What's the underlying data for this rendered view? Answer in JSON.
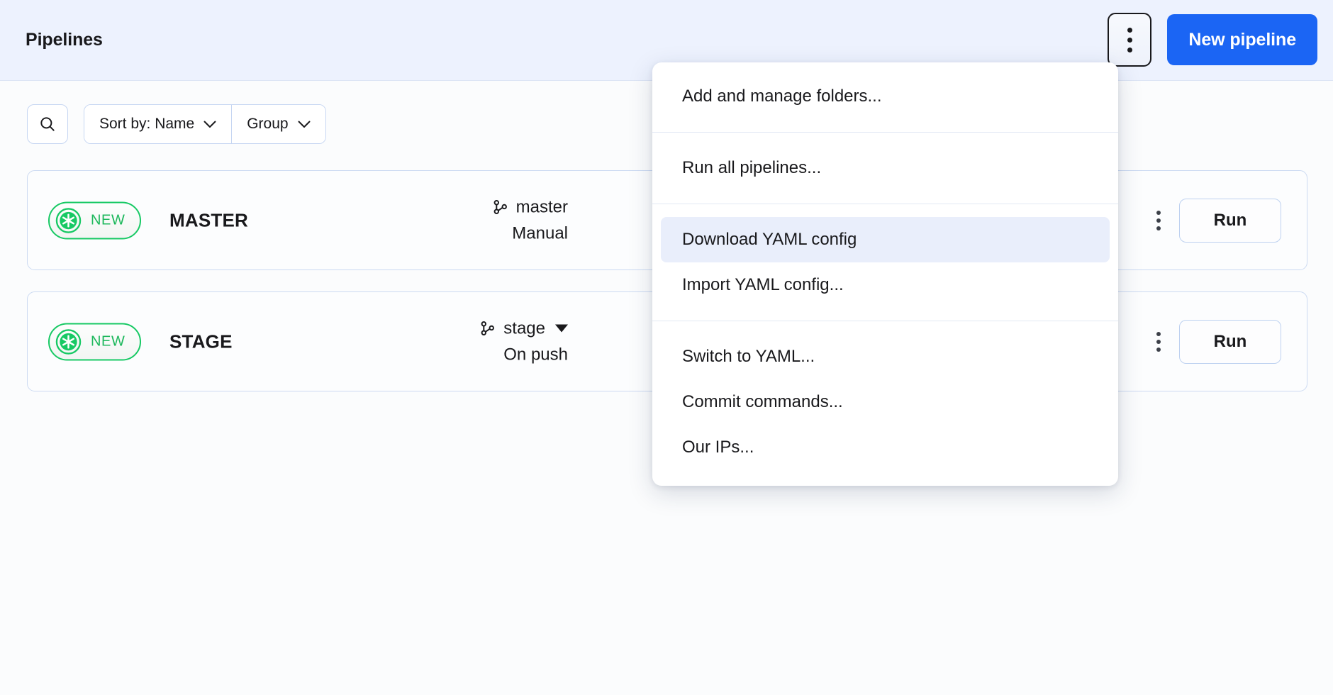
{
  "header": {
    "title": "Pipelines",
    "kebab_icon": "kebab-vertical-icon",
    "new_pipeline_label": "New pipeline",
    "accent_color": "#1b65f4",
    "background_color": "#edf2fe"
  },
  "toolbar": {
    "search_icon": "search-icon",
    "sort_label": "Sort by: Name",
    "sort_chevron_icon": "chevron-down-icon",
    "group_label": "Group",
    "group_chevron_icon": "chevron-down-icon"
  },
  "pipelines": [
    {
      "badge_label": "NEW",
      "badge_icon": "pipeline-status-new-icon",
      "badge_color": "#17c964",
      "name": "MASTER",
      "branch_icon": "git-branch-icon",
      "branch": "master",
      "branch_has_dropdown": false,
      "trigger": "Manual",
      "kebab_icon": "kebab-vertical-icon",
      "run_label": "Run"
    },
    {
      "badge_label": "NEW",
      "badge_icon": "pipeline-status-new-icon",
      "badge_color": "#17c964",
      "name": "STAGE",
      "branch_icon": "git-branch-icon",
      "branch": "stage",
      "branch_has_dropdown": true,
      "trigger": "On push",
      "kebab_icon": "kebab-vertical-icon",
      "run_label": "Run"
    }
  ],
  "menu": {
    "highlighted_item": "Download YAML config",
    "highlight_color": "#e9eefb",
    "groups": [
      {
        "items": [
          {
            "label": "Add and manage folders..."
          }
        ]
      },
      {
        "items": [
          {
            "label": "Run all pipelines..."
          }
        ]
      },
      {
        "items": [
          {
            "label": "Download YAML config",
            "highlighted": true
          },
          {
            "label": "Import YAML config..."
          }
        ]
      },
      {
        "items": [
          {
            "label": "Switch to YAML..."
          },
          {
            "label": "Commit commands..."
          },
          {
            "label": "Our IPs..."
          }
        ]
      }
    ]
  }
}
